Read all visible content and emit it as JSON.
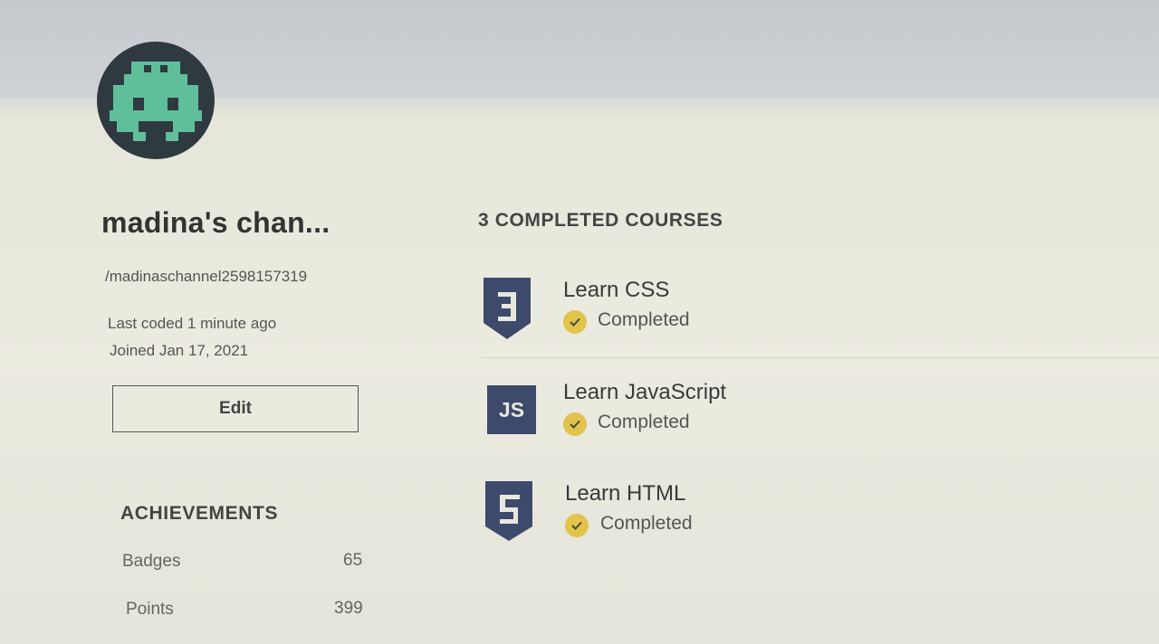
{
  "profile": {
    "username": "madina's chan...",
    "handle": "/madinaschannel2598157319",
    "last_coded": "Last coded 1 minute ago",
    "joined": "Joined Jan 17, 2021",
    "edit_label": "Edit",
    "avatar_icon": "pixel-alien-icon"
  },
  "achievements": {
    "title": "ACHIEVEMENTS",
    "items": [
      {
        "label": "Badges",
        "value": "65"
      },
      {
        "label": "Points",
        "value": "399"
      }
    ]
  },
  "courses": {
    "title": "3 COMPLETED COURSES",
    "items": [
      {
        "title": "Learn CSS",
        "status": "Completed",
        "icon": "css3-shield-icon",
        "badge_text": ""
      },
      {
        "title": "Learn JavaScript",
        "status": "Completed",
        "icon": "js-badge-icon",
        "badge_text": "JS"
      },
      {
        "title": "Learn HTML",
        "status": "Completed",
        "icon": "html5-shield-icon",
        "badge_text": ""
      }
    ]
  },
  "colors": {
    "badge": "#3e4a6b",
    "check": "#e2c44c",
    "avatar_bg": "#2f3a40",
    "avatar_fg": "#5fbf9a"
  }
}
